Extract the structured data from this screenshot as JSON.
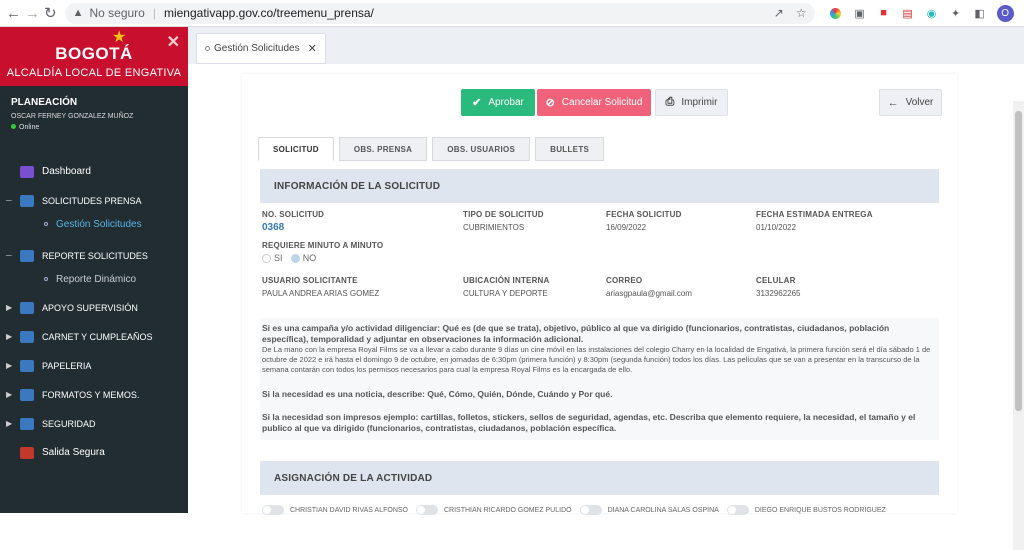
{
  "browser": {
    "security_label": "No seguro",
    "url": "miengativapp.gov.co/treemenu_prensa/",
    "profile_initial": "O"
  },
  "sidebar": {
    "brand_logo": "BOGOTÁ",
    "brand_subtitle": "ALCALDÍA LOCAL DE ENGATIVA",
    "user_area": "PLANEACIÓN",
    "user_name": "OSCAR FERNEY GONZALEZ MUÑOZ",
    "user_status": "Online",
    "items": [
      {
        "label": "Dashboard",
        "color": "#7b4fd1"
      },
      {
        "label": "SOLICITUDES PRENSA",
        "color": "#3a78c0"
      },
      {
        "label": "REPORTE SOLICITUDES",
        "color": "#3a78c0"
      },
      {
        "label": "APOYO SUPERVISIÓN",
        "color": "#3a78c0"
      },
      {
        "label": "CARNET Y CUMPLEAÑOS",
        "color": "#3a78c0"
      },
      {
        "label": "PAPELERIA",
        "color": "#3a78c0"
      },
      {
        "label": "FORMATOS Y MEMOS.",
        "color": "#3a78c0"
      },
      {
        "label": "SEGURIDAD",
        "color": "#3a78c0"
      },
      {
        "label": "Salida Segura",
        "color": "#c0392b"
      }
    ],
    "subitems": {
      "gestion": "Gestión Solicitudes",
      "reporte": "Reporte Dinámico"
    }
  },
  "page_tab": {
    "label": "Gestión Solicitudes"
  },
  "actions": {
    "aprobar": "Aprobar",
    "cancelar": "Cancelar Solicitud",
    "imprimir": "Imprimir",
    "volver": "Volver"
  },
  "content_tabs": [
    "SOLICITUD",
    "OBS. PRENSA",
    "OBS. USUARIOS",
    "BULLETS"
  ],
  "info": {
    "section_title": "INFORMACIÓN DE LA SOLICITUD",
    "no_solicitud_label": "NO. SOLICITUD",
    "no_solicitud": "0368",
    "tipo_label": "TIPO DE SOLICITUD",
    "tipo": "CUBRIMIENTOS",
    "fecha_label": "FECHA SOLICITUD",
    "fecha": "16/09/2022",
    "fecha_entrega_label": "FECHA ESTIMADA ENTREGA",
    "fecha_entrega": "01/10/2022",
    "minuto_label": "REQUIERE MINUTO A MINUTO",
    "si": "SI",
    "no": "NO",
    "usuario_label": "USUARIO SOLICITANTE",
    "usuario": "PAULA ANDREA ARIAS GOMEZ",
    "ubicacion_label": "UBICACIÓN INTERNA",
    "ubicacion": "CULTURA Y DEPORTE",
    "correo_label": "CORREO",
    "correo": "ariasgpaula@gmail.com",
    "celular_label": "CELULAR",
    "celular": "3132962265"
  },
  "texts": {
    "q1": "Si es una campaña y/o actividad diligenciar: Qué es (de que se trata), objetivo, público al que va dirigido (funcionarios, contratistas, ciudadanos, población específica), temporalidad y adjuntar en observaciones la información adicional.",
    "a1": "De La mano con la empresa Royal Films se va a llevar a cabo durante 9 días un cine móvil en las instalaciones del colegio Charry en la localidad de Engativá, la primera función será el día sábado 1 de octubre de 2022 e irá hasta el domingo 9 de octubre, en jornadas de 6:30pm (primera función) y 8:30pm (segunda función) todos los días. Las películas que se van a presentar en la transcurso de la semana contarán con todos los permisos necesarios para cual la empresa Royal Films es la encargada de ello.",
    "q2": "Si la necesidad es una noticia, describe: Qué, Cómo, Quién, Dónde, Cuándo y Por qué.",
    "q3": "Si la necesidad son impresos ejemplo: cartillas, folletos, stickers, sellos de seguridad, agendas, etc. Describa que elemento requiere, la necesidad, el tamaño y el publico al que va dirigido (funcionarios, contratistas, ciudadanos, población específica."
  },
  "asignacion": {
    "section_title": "ASIGNACIÓN DE LA ACTIVIDAD",
    "people": [
      "CHRISTIAN DAVID RIVAS ALFONSO",
      "CRISTHIAN RICARDO GOMEZ PULIDO",
      "DIANA CAROLINA SALAS OSPINA",
      "DIEGO ENRIQUE BUSTOS RODRIGUEZ"
    ]
  }
}
